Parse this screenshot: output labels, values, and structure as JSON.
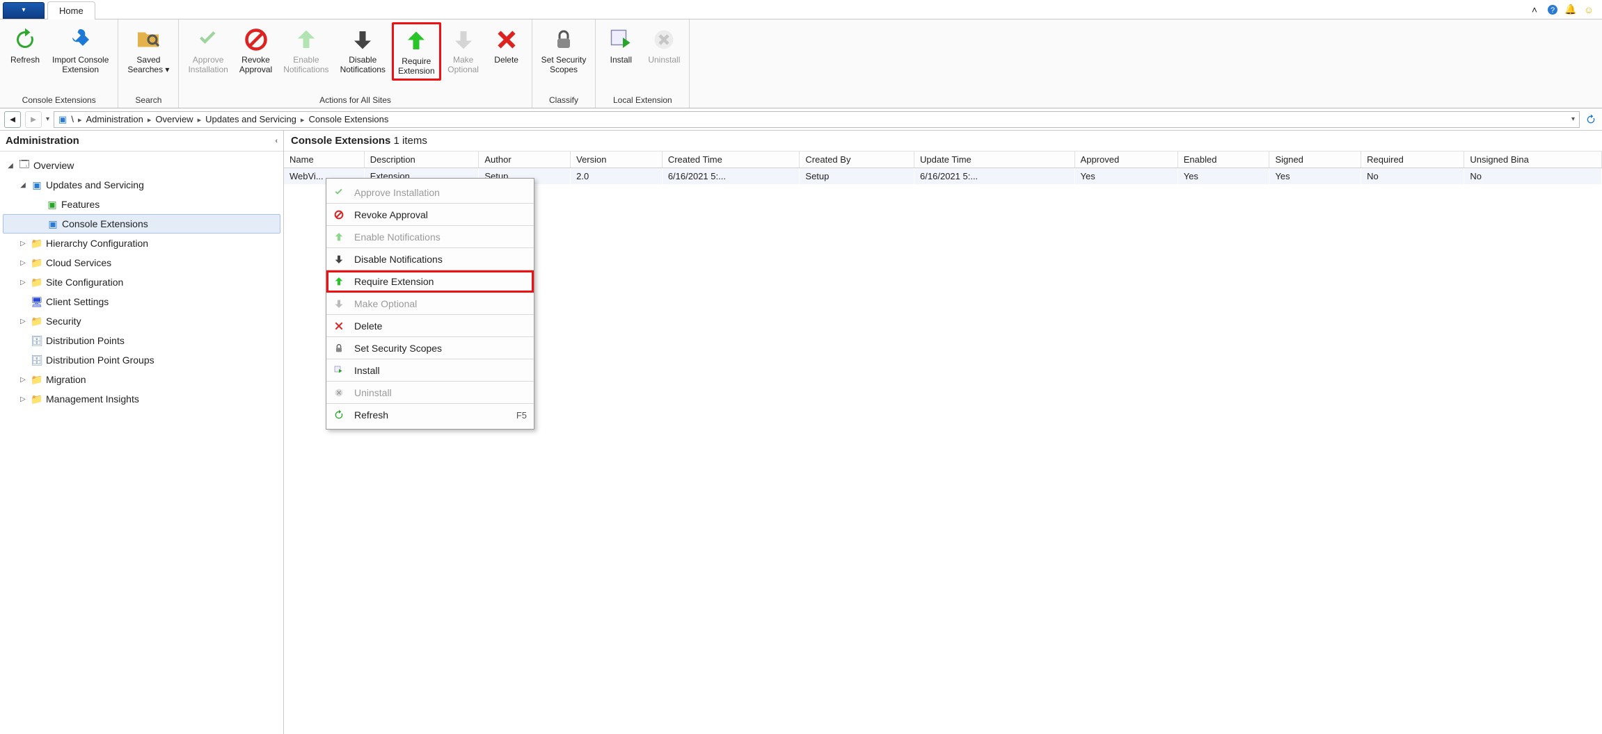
{
  "tabs": {
    "home": "Home"
  },
  "ribbon": {
    "groups": {
      "console_ext": {
        "label": "Console Extensions",
        "refresh": "Refresh",
        "import": "Import Console\nExtension"
      },
      "search": {
        "label": "Search",
        "saved_searches": "Saved\nSearches ▾"
      },
      "actions": {
        "label": "Actions for All Sites",
        "approve": "Approve\nInstallation",
        "revoke": "Revoke\nApproval",
        "enable_notif": "Enable\nNotifications",
        "disable_notif": "Disable\nNotifications",
        "require": "Require\nExtension",
        "make_optional": "Make\nOptional",
        "delete": "Delete"
      },
      "classify": {
        "label": "Classify",
        "set_scopes": "Set Security\nScopes"
      },
      "local": {
        "label": "Local Extension",
        "install": "Install",
        "uninstall": "Uninstall"
      }
    }
  },
  "breadcrumb": {
    "root": "\\",
    "items": [
      "Administration",
      "Overview",
      "Updates and Servicing",
      "Console Extensions"
    ]
  },
  "sidebar": {
    "title": "Administration",
    "nodes": {
      "overview": "Overview",
      "updates": "Updates and Servicing",
      "features": "Features",
      "console_ext": "Console Extensions",
      "hierarchy": "Hierarchy Configuration",
      "cloud": "Cloud Services",
      "site": "Site Configuration",
      "client": "Client Settings",
      "security": "Security",
      "dist_points": "Distribution Points",
      "dist_groups": "Distribution Point Groups",
      "migration": "Migration",
      "mgmt": "Management Insights"
    }
  },
  "content": {
    "header_title": "Console Extensions",
    "header_count": "1 items",
    "columns": [
      "Name",
      "Description",
      "Author",
      "Version",
      "Created Time",
      "Created By",
      "Update Time",
      "Approved",
      "Enabled",
      "Signed",
      "Required",
      "Unsigned Bina"
    ],
    "rows": [
      {
        "name": "WebVi...",
        "description": "Extension...",
        "author": "Setup",
        "version": "2.0",
        "created_time": "6/16/2021 5:...",
        "created_by": "Setup",
        "update_time": "6/16/2021 5:...",
        "approved": "Yes",
        "enabled": "Yes",
        "signed": "Yes",
        "required": "No",
        "unsigned": "No"
      }
    ]
  },
  "context_menu": {
    "approve": "Approve Installation",
    "revoke": "Revoke Approval",
    "enable_notif": "Enable Notifications",
    "disable_notif": "Disable Notifications",
    "require": "Require Extension",
    "make_optional": "Make Optional",
    "delete": "Delete",
    "set_scopes": "Set Security Scopes",
    "install": "Install",
    "uninstall": "Uninstall",
    "refresh": "Refresh",
    "refresh_shortcut": "F5"
  }
}
